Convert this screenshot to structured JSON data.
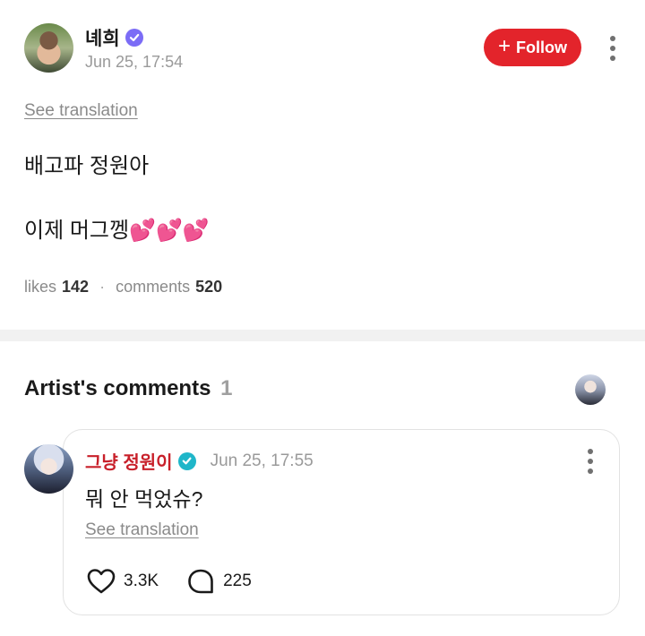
{
  "post": {
    "author": "녜희",
    "time": "Jun 25, 17:54",
    "follow_label": "Follow",
    "translate_label": "See translation",
    "lines": [
      "배고파 정원아",
      "이제 머그껭💕💕💕"
    ],
    "likes_label": "likes",
    "likes_count": "142",
    "comments_label": "comments",
    "comments_count": "520",
    "verified_color": "#7b6cf6"
  },
  "artist_comments": {
    "title": "Artist's comments",
    "count": "1",
    "comment": {
      "author": "그냥 정원이",
      "time": "Jun 25, 17:55",
      "text": "뭐 안 먹었슈?",
      "translate_label": "See translation",
      "likes": "3.3K",
      "replies": "225",
      "author_color": "#c8202a",
      "verified_color": "#1fb6c9"
    }
  },
  "colors": {
    "follow_button": "#e3242b"
  },
  "icons": [
    "verified-badge-icon",
    "plus-icon",
    "more-vertical-icon",
    "heart-outline-icon",
    "comment-bubble-icon"
  ]
}
